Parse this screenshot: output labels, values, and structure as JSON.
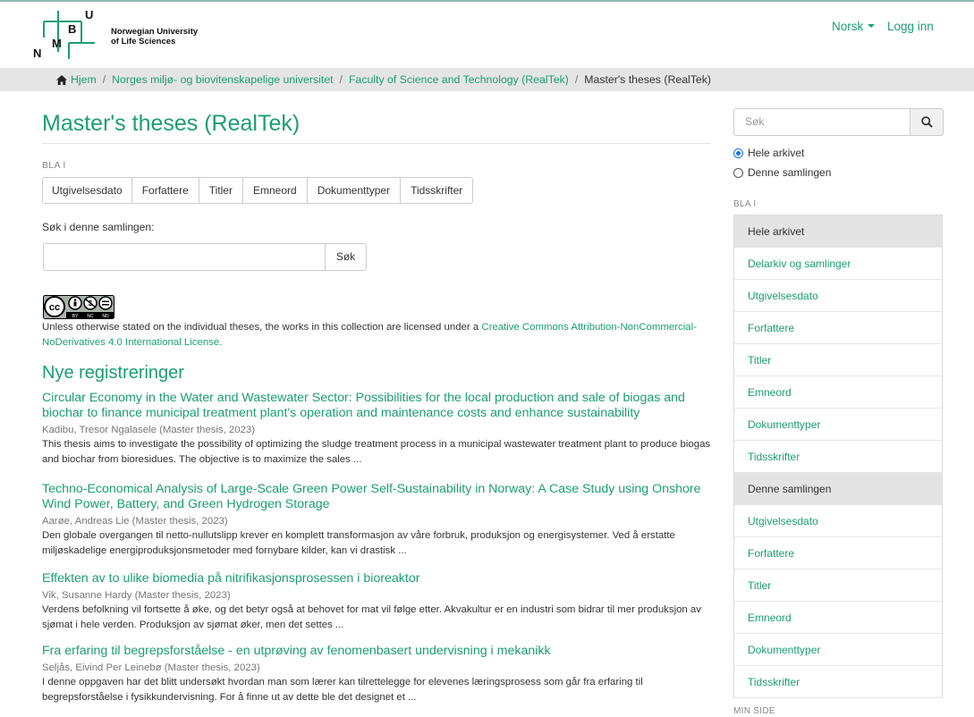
{
  "header": {
    "logo_letters": {
      "n": "N",
      "m": "M",
      "b": "B",
      "u": "U"
    },
    "logo_text_line1": "Norwegian University",
    "logo_text_line2": "of Life Sciences",
    "language_label": "Norsk",
    "login_label": "Logg inn"
  },
  "breadcrumb": {
    "items": [
      "Hjem",
      "Norges miljø- og biovitenskapelige universitet",
      "Faculty of Science and Technology (RealTek)"
    ],
    "current": "Master's theses (RealTek)",
    "separator": "/"
  },
  "main": {
    "title": "Master's theses (RealTek)",
    "browse_label": "BLA I",
    "browse_buttons": [
      "Utgivelsesdato",
      "Forfattere",
      "Titler",
      "Emneord",
      "Dokumenttyper",
      "Tidsskrifter"
    ],
    "search_label": "Søk i denne samlingen:",
    "search_value": "",
    "search_button": "Søk",
    "cc_badge_text": {
      "top": "BY",
      "nc": "NC",
      "nd": "ND"
    },
    "license_prefix": "Unless otherwise stated on the individual theses, the works in this collection are licensed under a ",
    "license_link": "Creative Commons Attribution-NonCommercial-NoDerivatives 4.0 International License.",
    "new_heading": "Nye registreringer",
    "items": [
      {
        "title": "Circular Economy in the Water and Wastewater Sector: Possibilities for the local production and sale of biogas and biochar to finance municipal treatment plant's operation and maintenance costs and enhance sustainability",
        "meta": "Kadibu, Tresor Ngalasele (Master thesis, 2023)",
        "abstract": "This thesis aims to investigate the possibility of optimizing the sludge treatment process in a municipal wastewater treatment plant to produce biogas and biochar from bioresidues. The objective is to maximize the sales ..."
      },
      {
        "title": "Techno-Economical Analysis of Large-Scale Green Power Self-Sustainability in Norway: A Case Study using Onshore Wind Power, Battery, and Green Hydrogen Storage",
        "meta": "Aarøe, Andreas Lie (Master thesis, 2023)",
        "abstract": "Den globale overgangen til netto-nullutslipp krever en komplett transformasjon av våre forbruk, produksjon og energisystemer. Ved å erstatte miljøskadelige energiproduksjonsmetoder med fornybare kilder, kan vi drastisk ..."
      },
      {
        "title": "Effekten av to ulike biomedia på nitrifikasjonsprosessen i bioreaktor",
        "meta": "Vik, Susanne Hardy (Master thesis, 2023)",
        "abstract": "Verdens befolkning vil fortsette å øke, og det betyr også at behovet for mat vil følge etter. Akvakultur er en industri som bidrar til mer produksjon av sjømat i hele verden. Produksjon av sjømat øker, men det settes ..."
      },
      {
        "title": "Fra erfaring til begrepsforståelse - en utprøving av fenomenbasert undervisning i mekanikk",
        "meta": "Seljås, Eivind Per Leinebø (Master thesis, 2023)",
        "abstract": "I denne oppgaven har det blitt undersøkt hvordan man som lærer kan tilrettelegge for elevenes læringsprosess som går fra erfaring til begrepsforståelse i fysikkundervisning. For å finne ut av dette ble det designet et ..."
      }
    ]
  },
  "sidebar": {
    "search_placeholder": "Søk",
    "radio_all": "Hele arkivet",
    "radio_collection": "Denne samlingen",
    "browse_label": "BLA I",
    "group_all": "Hele arkivet",
    "group_all_items": [
      "Delarkiv og samlinger",
      "Utgivelsesdato",
      "Forfattere",
      "Titler",
      "Emneord",
      "Dokumenttyper",
      "Tidsskrifter"
    ],
    "group_collection": "Denne samlingen",
    "group_collection_items": [
      "Utgivelsesdato",
      "Forfattere",
      "Titler",
      "Emneord",
      "Dokumenttyper",
      "Tidsskrifter"
    ],
    "more_label": "MIN SIDE"
  },
  "colors": {
    "accent": "#1c9e74",
    "breadcrumb_bg": "#e5e5e5",
    "sidebar_head_bg": "#e4e4e4"
  },
  "icons": {
    "home": "home-icon",
    "search": "search-icon",
    "caret": "caret-down-icon"
  }
}
